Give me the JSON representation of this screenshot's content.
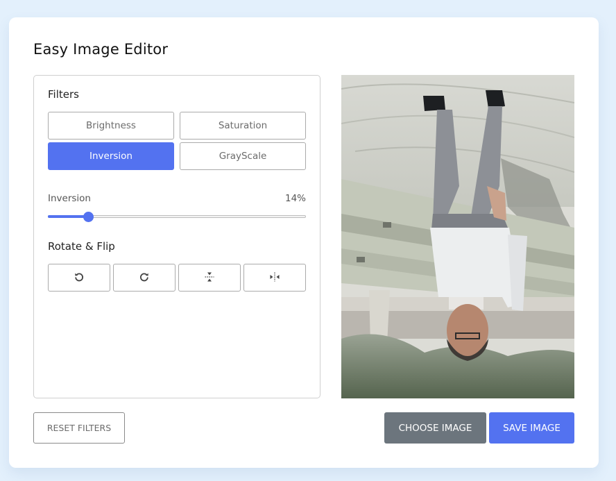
{
  "app": {
    "title": "Easy Image Editor"
  },
  "filters": {
    "label": "Filters",
    "buttons": [
      {
        "label": "Brightness",
        "active": false
      },
      {
        "label": "Saturation",
        "active": false
      },
      {
        "label": "Inversion",
        "active": true
      },
      {
        "label": "GrayScale",
        "active": false
      }
    ]
  },
  "slider": {
    "name": "Inversion",
    "value_text": "14%",
    "value": 14,
    "min": 0,
    "max": 100
  },
  "rotate": {
    "label": "Rotate & Flip",
    "buttons": [
      {
        "icon": "rotate-left-icon"
      },
      {
        "icon": "rotate-right-icon"
      },
      {
        "icon": "flip-vertical-icon"
      },
      {
        "icon": "flip-horizontal-icon"
      }
    ]
  },
  "actions": {
    "reset_label": "RESET FILTERS",
    "choose_label": "CHOOSE IMAGE",
    "save_label": "SAVE IMAGE"
  },
  "colors": {
    "accent": "#5372f0",
    "choose_bg": "#6c757d",
    "page_bg": "#e3f0fc"
  }
}
